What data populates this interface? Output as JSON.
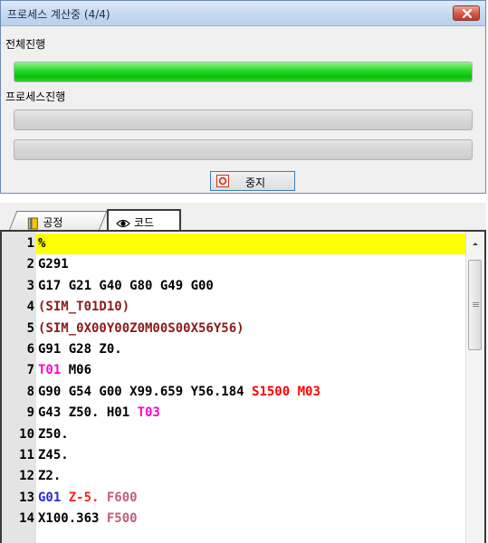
{
  "dialog": {
    "title": "프로세스 계산중 (4/4)",
    "overall_label": "전체진행",
    "process_label": "프로세스진행",
    "overall_progress": 1.0,
    "process_progress": 0.0,
    "stop_label": "중지"
  },
  "tabs": [
    {
      "label": "공정",
      "icon": "process-book-icon"
    },
    {
      "label": "코드",
      "icon": "eye-icon"
    }
  ],
  "code_lines": [
    {
      "n": "1",
      "tokens": [
        {
          "t": "%",
          "c": "def"
        }
      ]
    },
    {
      "n": "2",
      "tokens": [
        {
          "t": "G291",
          "c": "def"
        }
      ]
    },
    {
      "n": "3",
      "tokens": [
        {
          "t": "G17 G21 G40 G80 G49 G00",
          "c": "def"
        }
      ]
    },
    {
      "n": "4",
      "tokens": [
        {
          "t": "(SIM_T01D10)",
          "c": "paren"
        }
      ]
    },
    {
      "n": "5",
      "tokens": [
        {
          "t": "(SIM_0X00Y00Z0M00S00X56Y56)",
          "c": "paren"
        }
      ]
    },
    {
      "n": "6",
      "tokens": [
        {
          "t": "G91 G28 Z0.",
          "c": "def"
        }
      ]
    },
    {
      "n": "7",
      "tokens": [
        {
          "t": "T01",
          "c": "tool"
        },
        {
          "t": " M06",
          "c": "def"
        }
      ]
    },
    {
      "n": "8",
      "tokens": [
        {
          "t": "G90 G54 G00 X99.659 Y56.184 ",
          "c": "def"
        },
        {
          "t": "S1500 M03",
          "c": "spindle"
        }
      ]
    },
    {
      "n": "9",
      "tokens": [
        {
          "t": "G43 Z50. H01 ",
          "c": "def"
        },
        {
          "t": "T03",
          "c": "tool"
        }
      ]
    },
    {
      "n": "10",
      "tokens": [
        {
          "t": "Z50.",
          "c": "def"
        }
      ]
    },
    {
      "n": "11",
      "tokens": [
        {
          "t": "Z45.",
          "c": "def"
        }
      ]
    },
    {
      "n": "12",
      "tokens": [
        {
          "t": "Z2.",
          "c": "def"
        }
      ]
    },
    {
      "n": "13",
      "tokens": [
        {
          "t": "G01",
          "c": "gblue"
        },
        {
          "t": " Z-5.",
          "c": "z"
        },
        {
          "t": " F600",
          "c": "feed"
        }
      ]
    },
    {
      "n": "14",
      "tokens": [
        {
          "t": "X100.363",
          "c": "def"
        },
        {
          "t": " F500",
          "c": "feed"
        }
      ]
    }
  ],
  "highlighted_line": "1",
  "colors": {
    "progress_green": "#22d022",
    "highlight": "#ffff00",
    "tool": "#ff00cc",
    "spindle": "#ff0000",
    "feed": "#c0607a",
    "comment": "#8b1a1a",
    "g01": "#2a2ad8"
  }
}
